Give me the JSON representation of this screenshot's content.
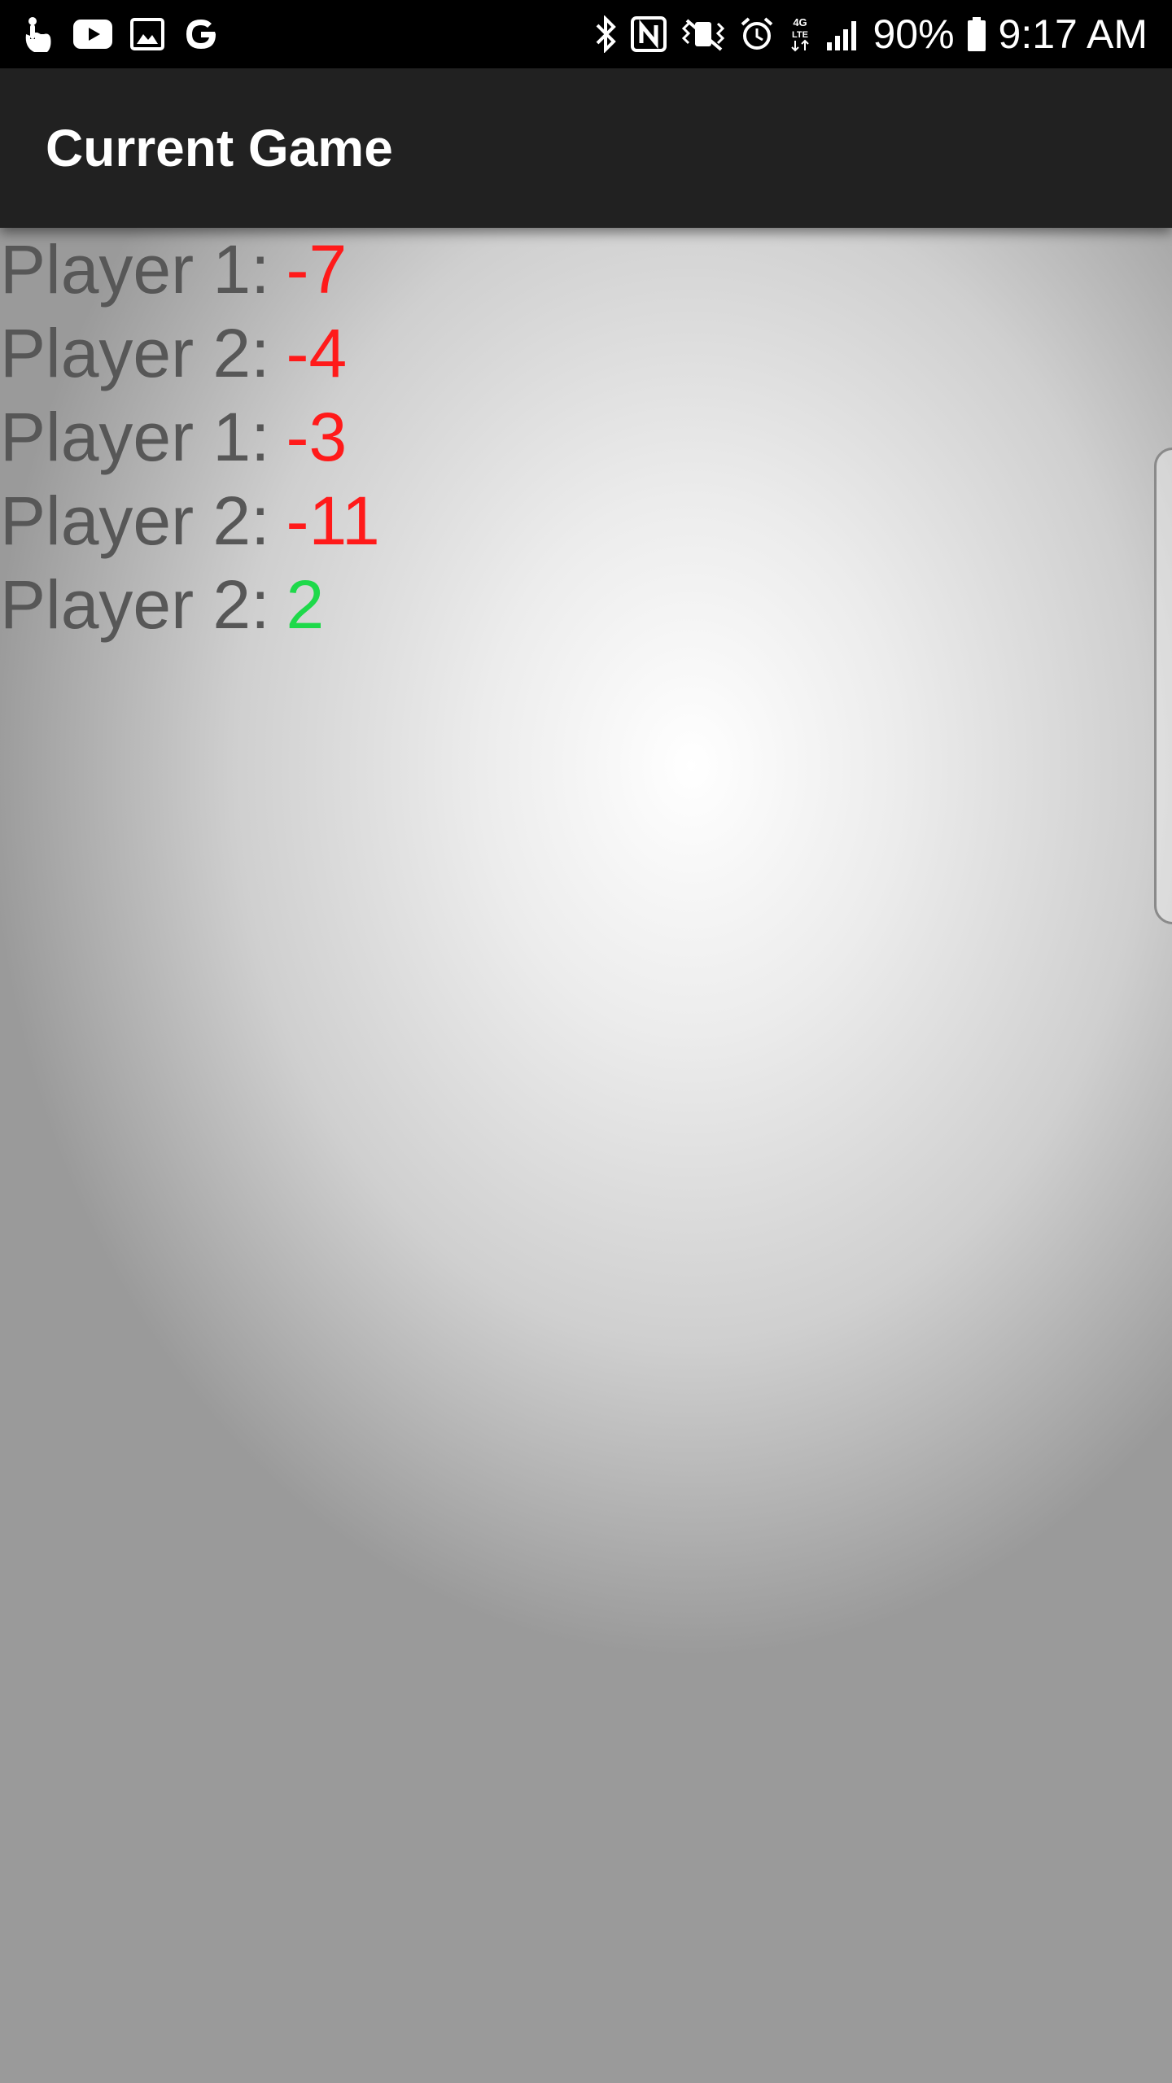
{
  "status_bar": {
    "left_icons": [
      "touch-gesture-icon",
      "youtube-icon",
      "gallery-icon",
      "google-icon"
    ],
    "right_icons": [
      "bluetooth-icon",
      "nfc-icon",
      "vibrate-icon",
      "alarm-icon",
      "lte-icon",
      "signal-icon"
    ],
    "battery_percent": "90%",
    "time": "9:17 AM"
  },
  "app_bar": {
    "title": "Current Game"
  },
  "scores": [
    {
      "label": "Player 1:",
      "value": "-7",
      "color": "#ff1a1a"
    },
    {
      "label": "Player 2:",
      "value": "-4",
      "color": "#ff1a1a"
    },
    {
      "label": "Player 1:",
      "value": "-3",
      "color": "#ff1a1a"
    },
    {
      "label": "Player 2:",
      "value": "-11",
      "color": "#ff1a1a"
    },
    {
      "label": "Player 2:",
      "value": "2",
      "color": "#1ed94a"
    }
  ],
  "colors": {
    "app_bar": "#212121",
    "label_text": "#575757",
    "negative": "#ff1a1a",
    "positive": "#1ed94a"
  }
}
